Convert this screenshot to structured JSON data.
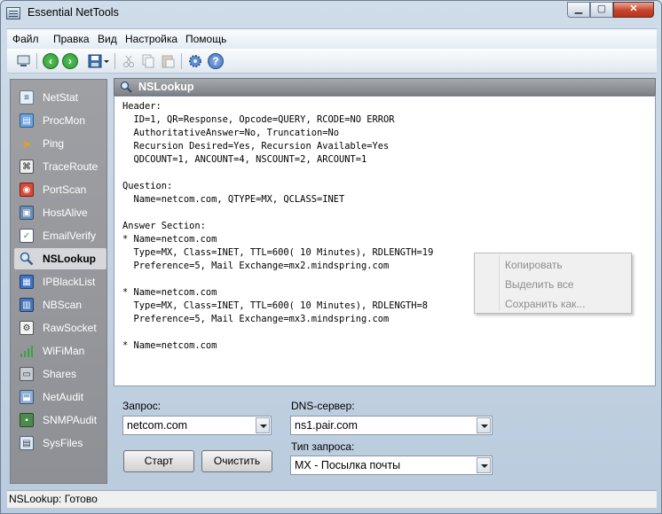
{
  "window": {
    "title": "Essential NetTools"
  },
  "menu": [
    "Файл",
    "Правка",
    "Вид",
    "Настройка",
    "Помощь"
  ],
  "sidebar": {
    "items": [
      {
        "label": "NetStat",
        "icon": "netstat-icon"
      },
      {
        "label": "ProcMon",
        "icon": "procmon-icon"
      },
      {
        "label": "Ping",
        "icon": "ping-icon"
      },
      {
        "label": "TraceRoute",
        "icon": "traceroute-icon"
      },
      {
        "label": "PortScan",
        "icon": "portscan-icon"
      },
      {
        "label": "HostAlive",
        "icon": "hostalive-icon"
      },
      {
        "label": "EmailVerify",
        "icon": "emailverify-icon"
      },
      {
        "label": "NSLookup",
        "icon": "magnifier-icon",
        "active": true
      },
      {
        "label": "IPBlackList",
        "icon": "ipblacklist-icon"
      },
      {
        "label": "NBScan",
        "icon": "nbscan-icon"
      },
      {
        "label": "RawSocket",
        "icon": "rawsocket-icon"
      },
      {
        "label": "WiFiMan",
        "icon": "wifi-signal-icon"
      },
      {
        "label": "Shares",
        "icon": "shares-icon"
      },
      {
        "label": "NetAudit",
        "icon": "netaudit-icon"
      },
      {
        "label": "SNMPAudit",
        "icon": "snmpaudit-icon"
      },
      {
        "label": "SysFiles",
        "icon": "sysfiles-icon"
      }
    ]
  },
  "panel": {
    "title": "NSLookup",
    "output_lines": [
      "Header:",
      "  ID=1, QR=Response, Opcode=QUERY, RCODE=NO ERROR",
      "  AuthoritativeAnswer=No, Truncation=No",
      "  Recursion Desired=Yes, Recursion Available=Yes",
      "  QDCOUNT=1, ANCOUNT=4, NSCOUNT=2, ARCOUNT=1",
      "",
      "Question:",
      "  Name=netcom.com, QTYPE=MX, QCLASS=INET",
      "",
      "Answer Section:",
      "* Name=netcom.com",
      "  Type=MX, Class=INET, TTL=600( 10 Minutes), RDLENGTH=19",
      "  Preference=5, Mail Exchange=mx2.mindspring.com",
      "",
      "* Name=netcom.com",
      "  Type=MX, Class=INET, TTL=600( 10 Minutes), RDLENGTH=8",
      "  Preference=5, Mail Exchange=mx3.mindspring.com",
      "",
      "* Name=netcom.com"
    ]
  },
  "context_menu": {
    "items": [
      "Копировать",
      "Выделить все",
      "Сохранить как..."
    ]
  },
  "form": {
    "query_label": "Запрос:",
    "query_value": "netcom.com",
    "dns_label": "DNS-сервер:",
    "dns_value": "ns1.pair.com",
    "type_label": "Тип запроса:",
    "type_value": "MX - Посылка почты",
    "start_button": "Старт",
    "clear_button": "Очистить"
  },
  "status": {
    "text": "NSLookup: Готово"
  },
  "colors": {
    "accent_green": "#2f9a35",
    "sidebar_bg": "#9ea0a4",
    "close_red": "#c7442b"
  }
}
